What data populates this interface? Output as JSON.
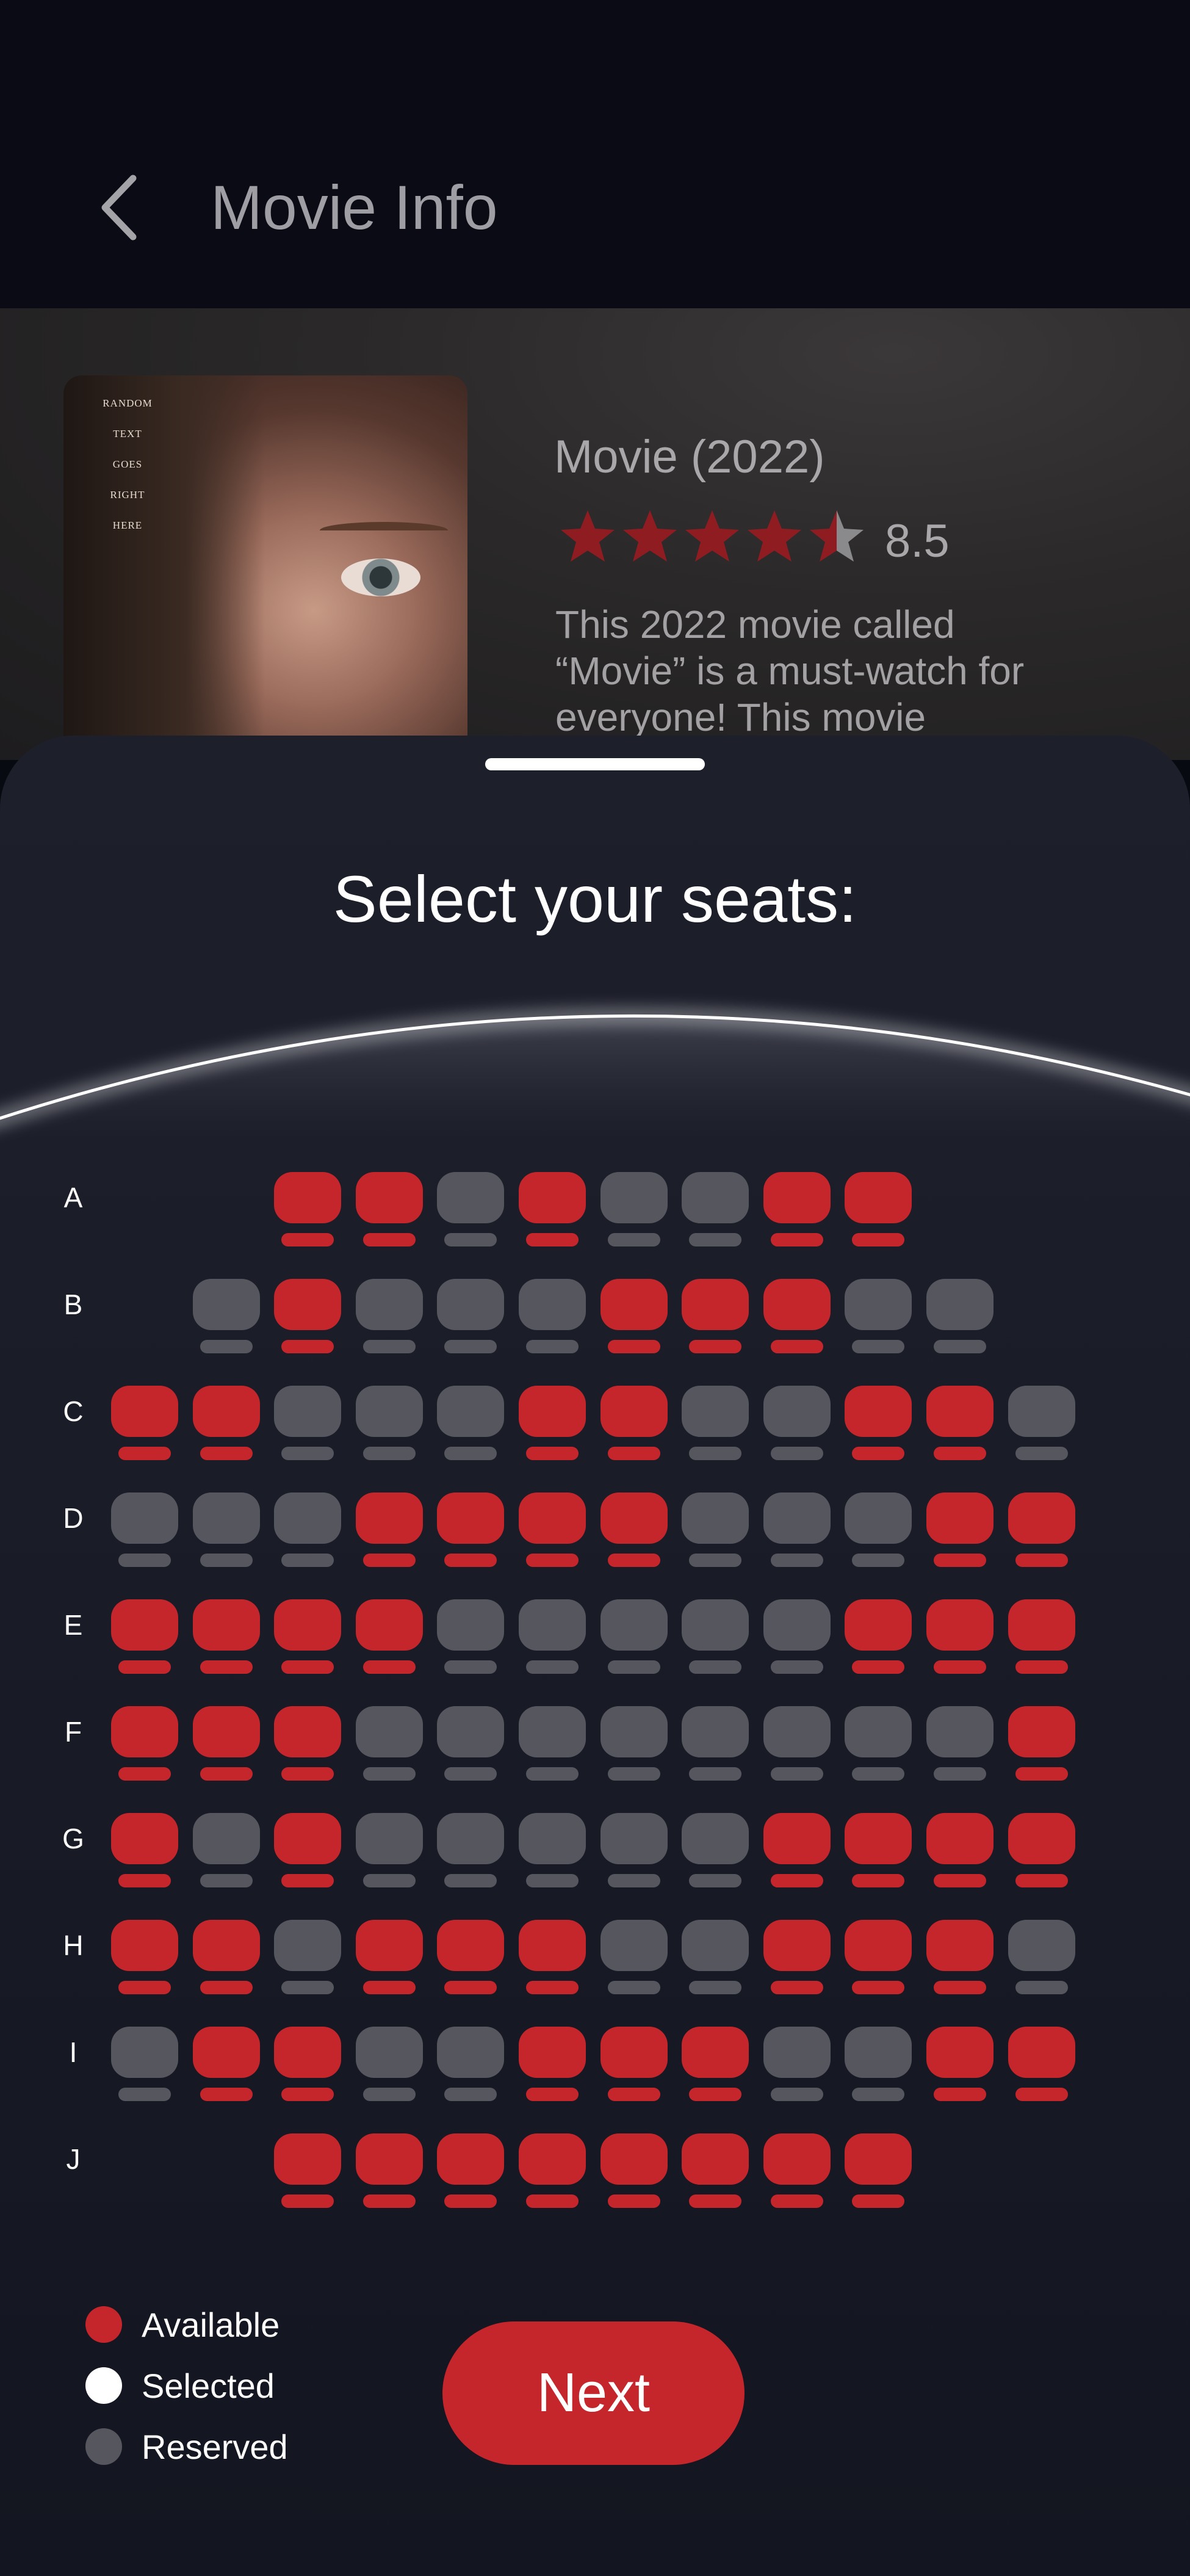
{
  "header": {
    "title": "Movie Info",
    "back_icon": "chevron-left-icon"
  },
  "movie": {
    "poster_text": [
      "RANDOM",
      "TEXT",
      "GOES",
      "RIGHT",
      "HERE"
    ],
    "title": "Movie (2022)",
    "rating_stars": 4.5,
    "rating_max": 5,
    "rating": "8.5",
    "description": "This 2022 movie called “Movie” is a must-watch for everyone! This movie"
  },
  "sheet": {
    "title": "Select your seats:"
  },
  "seating": {
    "columns": 12,
    "rows": [
      {
        "label": "A",
        "seats": [
          "",
          "",
          "A",
          "A",
          "R",
          "A",
          "R",
          "R",
          "A",
          "A",
          "",
          ""
        ]
      },
      {
        "label": "B",
        "seats": [
          "",
          "R",
          "A",
          "R",
          "R",
          "R",
          "A",
          "A",
          "A",
          "R",
          "R",
          ""
        ]
      },
      {
        "label": "C",
        "seats": [
          "A",
          "A",
          "R",
          "R",
          "R",
          "A",
          "A",
          "R",
          "R",
          "A",
          "A",
          "R"
        ]
      },
      {
        "label": "D",
        "seats": [
          "R",
          "R",
          "R",
          "A",
          "A",
          "A",
          "A",
          "R",
          "R",
          "R",
          "A",
          "A"
        ]
      },
      {
        "label": "E",
        "seats": [
          "A",
          "A",
          "A",
          "A",
          "R",
          "R",
          "R",
          "R",
          "R",
          "A",
          "A",
          "A"
        ]
      },
      {
        "label": "F",
        "seats": [
          "A",
          "A",
          "A",
          "R",
          "R",
          "R",
          "R",
          "R",
          "R",
          "R",
          "R",
          "A"
        ]
      },
      {
        "label": "G",
        "seats": [
          "A",
          "R",
          "A",
          "R",
          "R",
          "R",
          "R",
          "R",
          "A",
          "A",
          "A",
          "A"
        ]
      },
      {
        "label": "H",
        "seats": [
          "A",
          "A",
          "R",
          "A",
          "A",
          "A",
          "R",
          "R",
          "A",
          "A",
          "A",
          "R"
        ]
      },
      {
        "label": "I",
        "seats": [
          "R",
          "A",
          "A",
          "R",
          "R",
          "A",
          "A",
          "A",
          "R",
          "R",
          "A",
          "A"
        ]
      },
      {
        "label": "J",
        "seats": [
          "",
          "",
          "A",
          "A",
          "A",
          "A",
          "A",
          "A",
          "A",
          "A",
          "",
          ""
        ]
      }
    ]
  },
  "legend": [
    {
      "label": "Available",
      "color": "#c4262b"
    },
    {
      "label": "Selected",
      "color": "#ffffff"
    },
    {
      "label": "Reserved",
      "color": "#55565e"
    }
  ],
  "actions": {
    "next_label": "Next"
  },
  "colors": {
    "accent": "#c4262b",
    "reserved": "#55565e",
    "star_empty": "#8a8a8c"
  }
}
